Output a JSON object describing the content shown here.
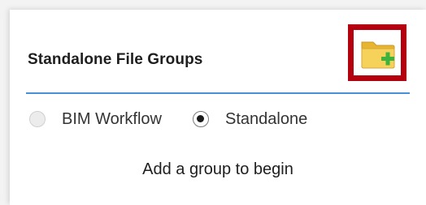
{
  "header": {
    "title": "Standalone File Groups",
    "add_button_icon": "folder-add-icon"
  },
  "mode_options": [
    {
      "label": "BIM Workflow",
      "selected": false
    },
    {
      "label": "Standalone",
      "selected": true
    }
  ],
  "empty_message": "Add a group to begin",
  "colors": {
    "accent_divider": "#4a90d9",
    "highlight_border": "#b5000f",
    "folder_yellow": "#f5c842",
    "plus_green": "#3cb33c"
  }
}
